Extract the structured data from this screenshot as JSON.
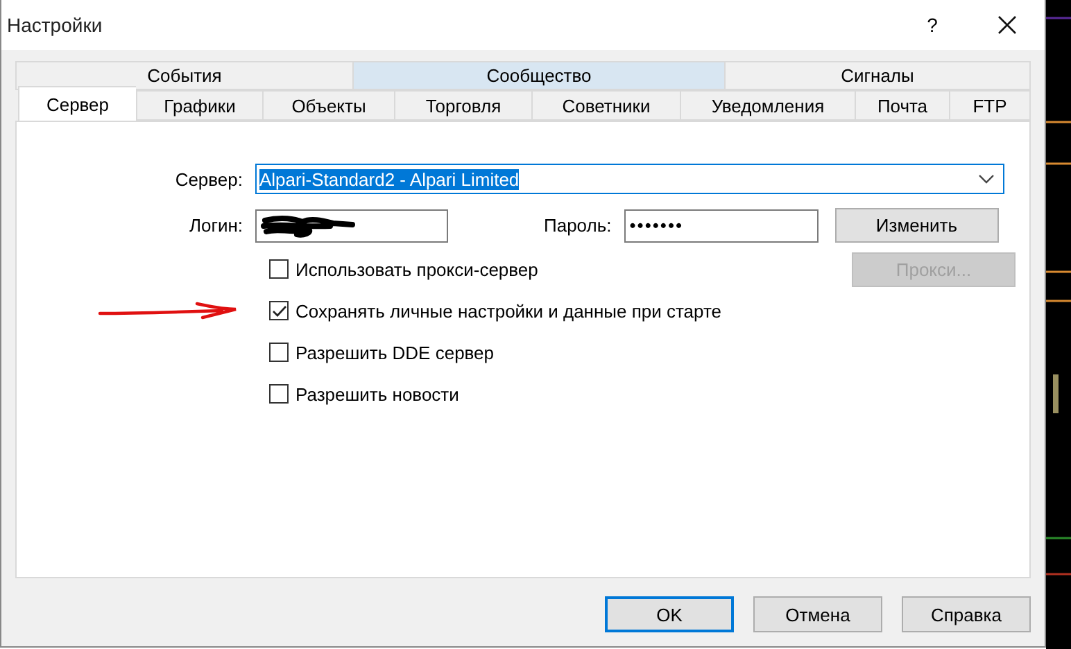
{
  "window": {
    "title": "Настройки",
    "help": "?"
  },
  "tab_rows": [
    [
      {
        "label": "События",
        "selected": false,
        "hover": false
      },
      {
        "label": "Сообщество",
        "selected": false,
        "hover": true
      },
      {
        "label": "Сигналы",
        "selected": false,
        "hover": false
      }
    ],
    [
      {
        "label": "Сервер",
        "selected": true,
        "hover": false
      },
      {
        "label": "Графики",
        "selected": false,
        "hover": false
      },
      {
        "label": "Объекты",
        "selected": false,
        "hover": false
      },
      {
        "label": "Торговля",
        "selected": false,
        "hover": false
      },
      {
        "label": "Советники",
        "selected": false,
        "hover": false
      },
      {
        "label": "Уведомления",
        "selected": false,
        "hover": false
      },
      {
        "label": "Почта",
        "selected": false,
        "hover": false
      },
      {
        "label": "FTP",
        "selected": false,
        "hover": false
      }
    ]
  ],
  "server": {
    "label": "Сервер:",
    "value": "Alpari-Standard2 - Alpari Limited",
    "text_selected": true
  },
  "login": {
    "label": "Логин:",
    "redacted": true
  },
  "password": {
    "label": "Пароль:",
    "value": "•••••••"
  },
  "change_button": {
    "label": "Изменить",
    "disabled": false
  },
  "proxy_button": {
    "label": "Прокси...",
    "disabled": true
  },
  "checkboxes": [
    {
      "label": "Использовать прокси-сервер",
      "checked": false,
      "annotated": false
    },
    {
      "label": "Сохранять личные настройки и данные при старте",
      "checked": true,
      "annotated": true
    },
    {
      "label": "Разрешить DDE сервер",
      "checked": false,
      "annotated": false
    },
    {
      "label": "Разрешить новости",
      "checked": false,
      "annotated": false
    }
  ],
  "footer_buttons": [
    {
      "label": "OK",
      "default": true
    },
    {
      "label": "Отмена",
      "default": false
    },
    {
      "label": "Справка",
      "default": false
    }
  ]
}
